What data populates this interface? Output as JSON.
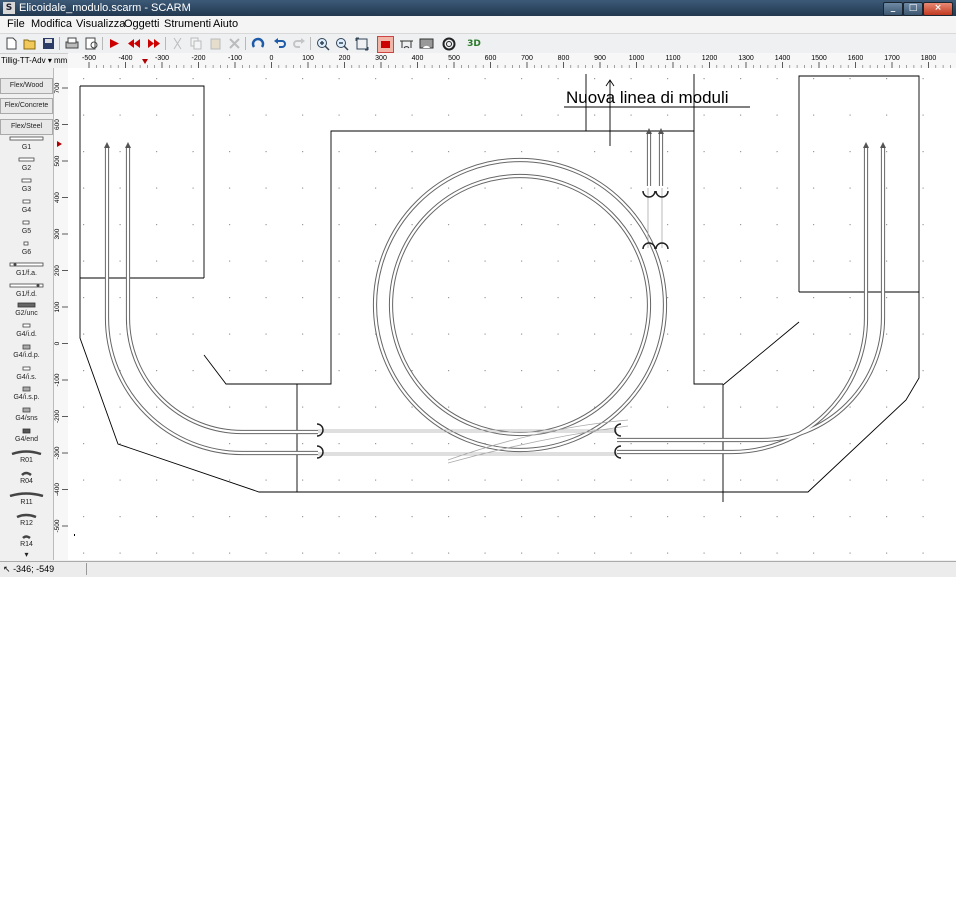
{
  "window": {
    "title": "Elicoidale_modulo.scarm - SCARM",
    "app_icon_glyph": "S",
    "minimize_glyph": "_",
    "maximize_glyph": "□",
    "close_glyph": "×"
  },
  "menu": {
    "items": [
      {
        "label": "File"
      },
      {
        "label": "Modifica"
      },
      {
        "label": "Visualizza"
      },
      {
        "label": "Oggetti"
      },
      {
        "label": "Strumenti"
      },
      {
        "label": "Aiuto"
      }
    ]
  },
  "toolbar": {
    "buttons": [
      {
        "name": "new-icon",
        "enabled": true
      },
      {
        "name": "open-icon",
        "enabled": true
      },
      {
        "name": "save-icon",
        "enabled": true
      },
      {
        "name": "print-icon",
        "enabled": true
      },
      {
        "name": "print-preview-icon",
        "enabled": true
      },
      {
        "name": "select-arrow-icon",
        "enabled": true
      },
      {
        "name": "rewind-icon",
        "enabled": true
      },
      {
        "name": "forward-icon",
        "enabled": true
      },
      {
        "name": "cut-icon",
        "enabled": false
      },
      {
        "name": "copy-icon",
        "enabled": false
      },
      {
        "name": "paste-icon",
        "enabled": false
      },
      {
        "name": "delete-icon",
        "enabled": false
      },
      {
        "name": "rotate-icon",
        "enabled": true
      },
      {
        "name": "undo-icon",
        "enabled": true
      },
      {
        "name": "redo-icon",
        "enabled": false
      },
      {
        "name": "zoom-in-icon",
        "enabled": true
      },
      {
        "name": "zoom-out-icon",
        "enabled": true
      },
      {
        "name": "zoom-fit-icon",
        "enabled": true
      },
      {
        "name": "layer-icon",
        "enabled": true
      },
      {
        "name": "bridge-icon",
        "enabled": true
      },
      {
        "name": "tunnel-icon",
        "enabled": true
      },
      {
        "name": "helix-icon",
        "enabled": true
      },
      {
        "name": "view-3d-icon",
        "enabled": true,
        "label": "3D"
      }
    ]
  },
  "library": {
    "selected": "Tillig-TT-Adv",
    "dropdown_glyph": "▾",
    "units": "mm"
  },
  "palette": {
    "items": [
      {
        "label": "Flex/Wood"
      },
      {
        "label": "Flex/Concrete"
      },
      {
        "label": "Flex/Steel"
      },
      {
        "label": "G1"
      },
      {
        "label": "G2"
      },
      {
        "label": "G3"
      },
      {
        "label": "G4"
      },
      {
        "label": "G5"
      },
      {
        "label": "G6"
      },
      {
        "label": "G1/f.a."
      },
      {
        "label": "G1/f.d."
      },
      {
        "label": "G2/unc"
      },
      {
        "label": "G4/i.d."
      },
      {
        "label": "G4/i.d.p."
      },
      {
        "label": "G4/i.s."
      },
      {
        "label": "G4/i.s.p."
      },
      {
        "label": "G4/sns"
      },
      {
        "label": "G4/end"
      },
      {
        "label": "R01"
      },
      {
        "label": "R04"
      },
      {
        "label": "R11"
      },
      {
        "label": "R12"
      },
      {
        "label": "R14"
      }
    ],
    "scroll_glyph": "▾"
  },
  "rulers": {
    "horizontal_ticks": [
      "-500",
      "-400",
      "-300",
      "-200",
      "-100",
      "0",
      "100",
      "200",
      "300",
      "400",
      "500",
      "600",
      "700",
      "800",
      "900",
      "1000",
      "1100",
      "1200",
      "1300",
      "1400",
      "1500",
      "1600",
      "1700",
      "1800"
    ],
    "vertical_ticks": [
      "700",
      "600",
      "500",
      "400",
      "300",
      "200",
      "100",
      "0",
      "-100",
      "-200",
      "-300",
      "-400",
      "-500"
    ]
  },
  "canvas": {
    "annotation": "Nuova linea di moduli"
  },
  "status": {
    "coordinates": "-346; -549"
  },
  "colors": {
    "titlebar": "#2d4863",
    "track": "#555555",
    "outline": "#000000",
    "grid_dot": "#9a9a9a",
    "accent_red": "#c00000"
  }
}
